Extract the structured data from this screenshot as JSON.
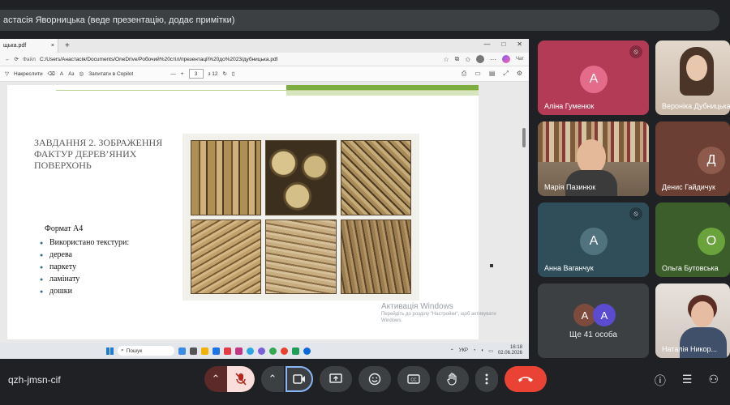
{
  "presenter_banner": "астасія Яворницька (веде презентацію, додає примітки)",
  "browser": {
    "tab_title": "щька.pdf",
    "tab_close": "×",
    "new_tab": "+",
    "win_minimize": "—",
    "win_restore": "□",
    "win_close": "✕",
    "file_label": "Файл",
    "address": "C:/Users/Анастасія/Documents/OneDrive/Робочий%20стіл/презентації%20до%2023/дубницька.pdf",
    "copilot_label": "Чат"
  },
  "pdf_toolbar": {
    "draw_label": "Накреслити",
    "aa": "A",
    "read_aloud": "Аз",
    "ask_copilot": "Запитати в Copilot",
    "minus": "—",
    "plus": "+",
    "page_current": "3",
    "page_total": "з 12"
  },
  "slide": {
    "title": "ЗАВДАННЯ 2. ЗОБРАЖЕННЯ ФАКТУР ДЕРЕВ’ЯНИХ ПОВЕРХОНЬ",
    "format": "Формат А4",
    "bullets": [
      "Використано текстури:",
      "дерева",
      "паркету",
      "ламінату",
      "дошки"
    ]
  },
  "watermark": {
    "title": "Активація Windows",
    "subtitle": "Перейдіть до розділу \"Настройки\", щоб активувати Windows."
  },
  "taskbar": {
    "search": "Пошук",
    "lang": "УКР",
    "time": "16:18",
    "date": "02.06.2026"
  },
  "participants": [
    {
      "name": "Аліна Гуменюк",
      "initial": "А",
      "color": "#b33b56",
      "avatar": "#e56b8a",
      "muted": true
    },
    {
      "name": "Вероніка Дубницька",
      "initial": "",
      "color": "#c9b9a9",
      "avatar": "",
      "muted": false
    },
    {
      "name": "Марія Пазинюк",
      "initial": "",
      "color": "#8d7b68",
      "avatar": "",
      "muted": false
    },
    {
      "name": "Денис Гайдичук",
      "initial": "Д",
      "color": "#6b3f33",
      "avatar": "#8d5a4b",
      "muted": false
    },
    {
      "name": "Анна Ваганчук",
      "initial": "А",
      "color": "#2f4e5a",
      "avatar": "#51737f",
      "muted": true
    },
    {
      "name": "Ольга Бутовська",
      "initial": "О",
      "color": "#3b5e2a",
      "avatar": "#6aa33c",
      "muted": false
    },
    {
      "name": "Наталія Никор...",
      "initial": "",
      "color": "#d7cfc9",
      "avatar": "",
      "muted": false
    }
  ],
  "more_participants": {
    "label": "Ще 41 особа",
    "initials": [
      "А",
      "А"
    ],
    "colors": [
      "#7d4b3c",
      "#5b4bd1"
    ]
  },
  "meeting_code": "qzh-jmsn-cif",
  "icons": {
    "mic_off": "mic-off-icon",
    "camera": "camera-icon",
    "present": "present-icon",
    "emoji": "emoji-icon",
    "captions": "captions-icon",
    "hand": "raise-hand-icon",
    "more": "more-vert-icon",
    "hangup": "hangup-icon",
    "info": "info-icon",
    "chat": "chat-icon",
    "people": "people-icon"
  },
  "colors": {
    "hangup": "#ea4335",
    "mic_off_bg": "#f9dedc",
    "accent_green": "#7dac3f"
  }
}
